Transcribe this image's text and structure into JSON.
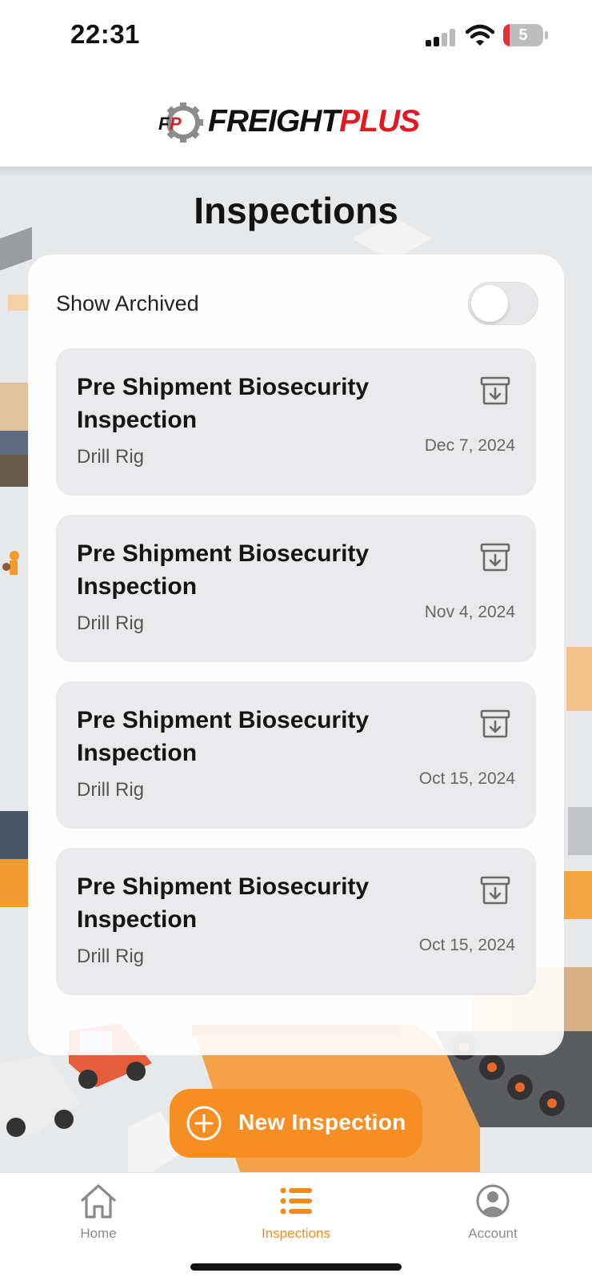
{
  "status_bar": {
    "time": "22:31",
    "battery_level": "5",
    "icons": [
      "cellular-signal-icon",
      "wifi-icon",
      "battery-icon"
    ]
  },
  "brand": {
    "logo_mark": "FP",
    "name_part1": "FREIGHT",
    "name_part2": "PLUS",
    "colors": {
      "dark": "#111111",
      "red": "#e01b24"
    }
  },
  "page": {
    "title": "Inspections"
  },
  "filters": {
    "show_archived_label": "Show Archived",
    "show_archived_on": false
  },
  "inspections": [
    {
      "title": "Pre Shipment Biosecurity Inspection",
      "subtitle": "Drill Rig",
      "date": "Dec 7, 2024",
      "icon": "archive-icon"
    },
    {
      "title": "Pre Shipment Biosecurity Inspection",
      "subtitle": "Drill Rig",
      "date": "Nov 4, 2024",
      "icon": "archive-icon"
    },
    {
      "title": "Pre Shipment Biosecurity Inspection",
      "subtitle": "Drill Rig",
      "date": "Oct 15, 2024",
      "icon": "archive-icon"
    },
    {
      "title": "Pre Shipment Biosecurity Inspection",
      "subtitle": "Drill Rig",
      "date": "Oct 15, 2024",
      "icon": "archive-icon"
    }
  ],
  "new_inspection_button": {
    "label": "New Inspection",
    "icon": "plus-circle-icon",
    "color": "#f78e24"
  },
  "tab_bar": {
    "tabs": [
      {
        "label": "Home",
        "icon": "home-icon",
        "active": false
      },
      {
        "label": "Inspections",
        "icon": "list-icon",
        "active": true
      },
      {
        "label": "Account",
        "icon": "account-icon",
        "active": false
      }
    ],
    "active_color": "#f08a1c",
    "inactive_color": "#8a8a8a"
  }
}
